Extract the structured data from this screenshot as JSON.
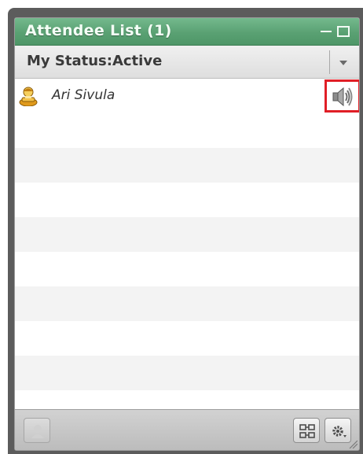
{
  "pod": {
    "title": "Attendee List (1)",
    "status_label": "My Status:Active"
  },
  "attendees": [
    {
      "name": "Ari Sivula",
      "role_icon": "presenter-icon",
      "audio_icon": "speaker-icon"
    }
  ],
  "footer": {
    "buttons": [
      "raise-hand-icon",
      "arrange-icon",
      "options-gear-icon"
    ]
  },
  "colors": {
    "title_bar": "#5aa173",
    "highlight": "#e01e26"
  }
}
